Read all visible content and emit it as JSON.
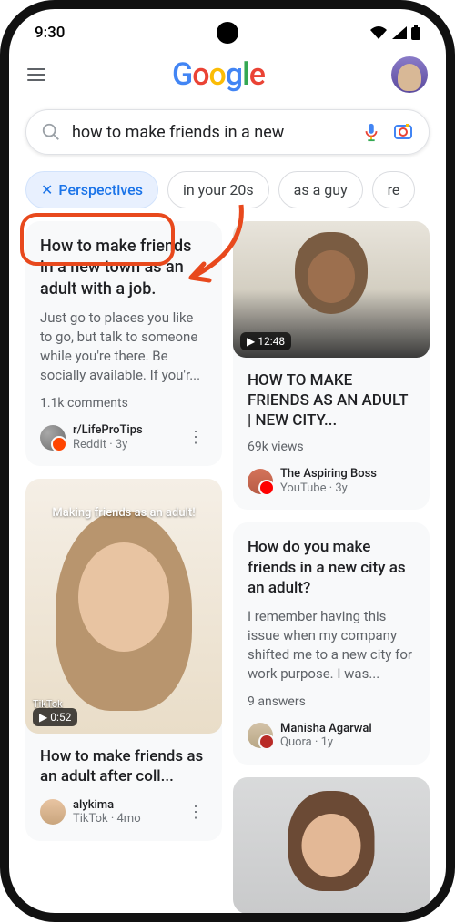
{
  "status": {
    "time": "9:30"
  },
  "logo_text": "Google",
  "search": {
    "query": "how to make friends in a new"
  },
  "chips": [
    {
      "label": "Perspectives",
      "active": true
    },
    {
      "label": "in your 20s",
      "active": false
    },
    {
      "label": "as a guy",
      "active": false
    },
    {
      "label": "re",
      "active": false
    }
  ],
  "cards": {
    "reddit": {
      "title": "How to make friends in a new town as an adult with a job.",
      "body": "Just go to places you like to go, but talk to someone while you're there. Be socially available. If you'r...",
      "meta": "1.1k comments",
      "source_name": "r/LifeProTips",
      "source_sub": "Reddit · 3y"
    },
    "youtube": {
      "duration": "12:48",
      "title": "HOW TO MAKE FRIENDS AS AN ADULT | NEW CITY...",
      "meta": "69k views",
      "source_name": "The Aspiring Boss",
      "source_sub": "YouTube · 3y"
    },
    "tiktok": {
      "caption": "Making friends as an adult!",
      "duration": "0:52",
      "tiktok_label": "TikTok",
      "title": "How to make friends as an adult after coll...",
      "source_name": "alykima",
      "source_sub": "TikTok · 4mo"
    },
    "quora": {
      "title": "How do you make friends in a new city as an adult?",
      "body": "I remember having this issue when my company shifted me to a new city for work purpose. I was...",
      "meta": "9 answers",
      "source_name": "Manisha Agarwal",
      "source_sub": "Quora · 1y"
    }
  }
}
